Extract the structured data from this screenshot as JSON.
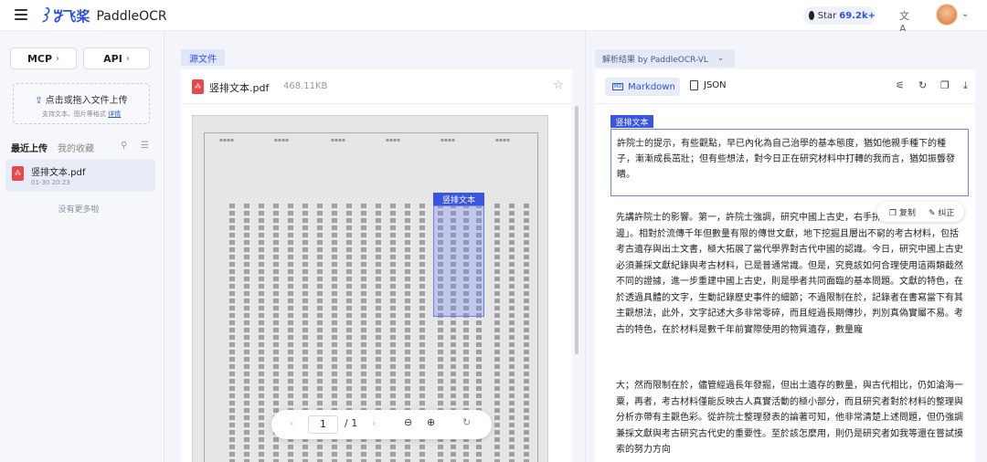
{
  "app": {
    "logo_mark": "꒱ꗌ",
    "logo_cn": "飞桨",
    "name": "PaddleOCR",
    "star_label": "Star",
    "star_count": "69.2k+"
  },
  "sidebar": {
    "mcp_label": "MCP",
    "api_label": "API",
    "upload_main": "点击或拖入文件上传",
    "upload_sub": "支持文本、图片等格式",
    "upload_link": "详情",
    "tab_recent": "最近上传",
    "tab_fav": "我的收藏",
    "files": [
      {
        "name": "竖排文本.pdf",
        "date": "01-30 20:23"
      }
    ],
    "no_more": "没有更多啦"
  },
  "source": {
    "tab_label": "源文件",
    "file_name": "竖排文本.pdf",
    "file_size": "468.11KB",
    "highlight_label": "竖排文本",
    "page_current": "1",
    "page_total": "/ 1"
  },
  "result": {
    "title": "解析结果 by PaddleOCR-VL",
    "tab_markdown": "Markdown",
    "tab_json": "JSON",
    "block_label": "竖排文本",
    "block_text": "許院士的提示，有些觀點，早已內化為自己治學的基本態度，猶如他親手種下的種子，漸漸成長茁壯；但有些想法，對今日正在研究材料中打轉的我而言，猶如振聾發瞶。",
    "para1": "先講許院士的影響。第一，許院士強調，研究中國上古史，右手拼考古，不能只抓一邊」。相對於流傳千年但數量有限的傳世文獻，地下挖掘且層出不窮的考古材料，包括考古遺存與出土文書，極大拓展了當代學界對古代中國的認識。今日，研究中國上古史必須兼採文獻紀錄與考古材料，已是普通常識。但是，究竟該如何合理使用這兩類截然不同的證據，進一步重建中國上古史，則是學者共同面臨的基本問題。文獻的特色，在於透過具體的文字，生動記錄歷史事件的細節；不過限制在於，記錄者在書寫當下有其主觀想法，此外，文字記述大多非常零碎，而且經過長期傳抄，判別真偽實屬不易。考古的特色，在於材料是數千年前實際使用的物質遺存，數量龐",
    "para2": "大；然而限制在於，儘管經過長年發掘，但出土遺存的數量，與古代相比，仍如滄海一粟，再者，考古材料僅能反映古人真實活動的極小部分，而且研究者對於材料的整理與分析亦帶有主觀色彩。從許院士整理發表的論著可知，他非常清楚上述問題，但仍強調兼採文獻與考古研究古代史的重要性。至於該怎麼用，則仍是研究者如我等還在嘗試摸索的努力方向",
    "copy_label": "复制",
    "fix_label": "纠正"
  }
}
